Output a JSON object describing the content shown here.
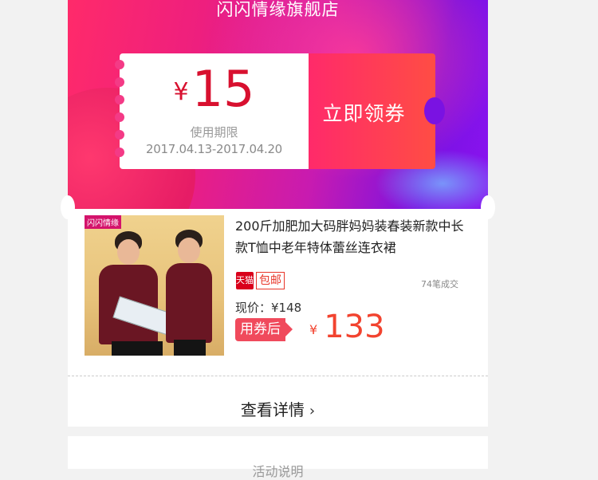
{
  "banner": {
    "store_name": "闪闪情缘旗舰店"
  },
  "coupon": {
    "currency": "¥",
    "amount": "15",
    "validity_label": "使用期限",
    "validity_dates": "2017.04.13-2017.04.20",
    "claim_button": "立即领券"
  },
  "product": {
    "image_tag": "闪闪情缘",
    "title": "200斤加肥加大码胖妈妈装春装新款中长款T恤中老年特体蕾丝连衣裙",
    "tmall_icon": "天猫",
    "free_shipping": "包邮",
    "sold": "74笔成交",
    "current_price": "现价：¥148",
    "after_coupon_label": "用券后",
    "final_currency": "¥",
    "final_price": "133"
  },
  "details_link": {
    "label": "查看详情",
    "chevron": "›"
  },
  "activity": {
    "label": "活动说明"
  },
  "colors": {
    "coupon_red": "#d8102f",
    "price_orange": "#f2432f",
    "badge_red": "#f04a5c"
  }
}
